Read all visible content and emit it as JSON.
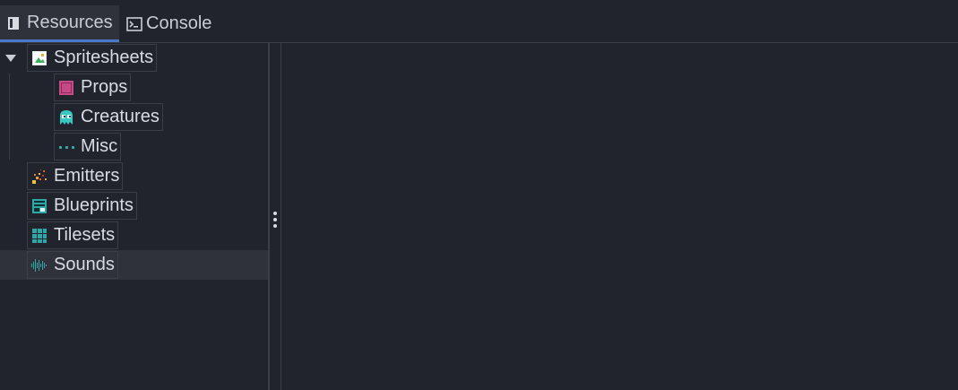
{
  "tabs": [
    {
      "label": "Resources",
      "icon": "document-icon",
      "active": true
    },
    {
      "label": "Console",
      "icon": "terminal-icon",
      "active": false
    }
  ],
  "tree": {
    "items": [
      {
        "label": "Spritesheets",
        "icon": "image-icon",
        "expanded": true
      },
      {
        "label": "Props",
        "icon": "square-icon"
      },
      {
        "label": "Creatures",
        "icon": "ghost-icon"
      },
      {
        "label": "Misc",
        "icon": "dots-icon"
      },
      {
        "label": "Emitters",
        "icon": "particles-icon"
      },
      {
        "label": "Blueprints",
        "icon": "blueprint-icon"
      },
      {
        "label": "Tilesets",
        "icon": "grid-icon"
      },
      {
        "label": "Sounds",
        "icon": "waveform-icon",
        "selected": true
      }
    ]
  },
  "colors": {
    "background": "#21242c",
    "tab_active_bg": "#2f323b",
    "tab_active_underline": "#4a78c8",
    "teal_icon": "#2ea7a7",
    "props_icon": "#c54a86"
  }
}
